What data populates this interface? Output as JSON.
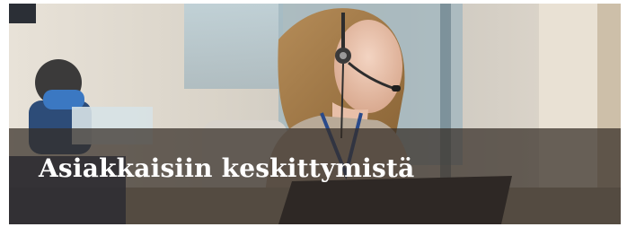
{
  "banner": {
    "title": "Asiakkaisiin keskittymistä",
    "overlay_color": "#342c26",
    "scene_description_icons": [
      "headset-icon"
    ]
  }
}
